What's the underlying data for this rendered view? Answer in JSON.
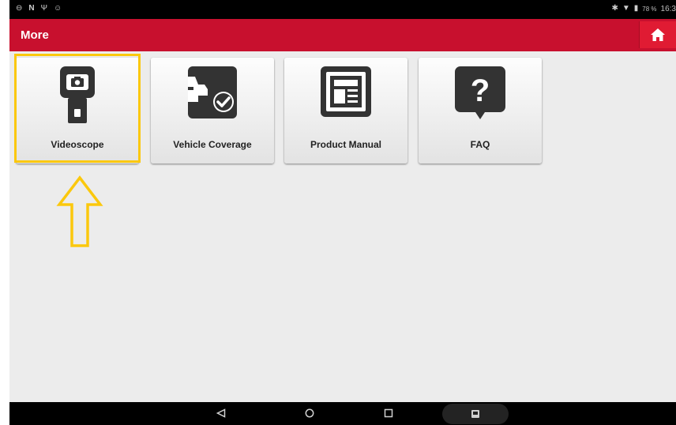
{
  "status_bar": {
    "left_icons": [
      "alarm-icon",
      "nfc-icon",
      "usb-icon",
      "android-icon"
    ],
    "battery": "78 %",
    "time": "16:3"
  },
  "app_bar": {
    "title": "More",
    "home_icon": "home-icon"
  },
  "tiles": [
    {
      "label": "Videoscope",
      "icon": "videoscope-icon"
    },
    {
      "label": "Vehicle Coverage",
      "icon": "vehicle-coverage-icon"
    },
    {
      "label": "Product Manual",
      "icon": "product-manual-icon"
    },
    {
      "label": "FAQ",
      "icon": "faq-icon"
    }
  ],
  "nav_bar": {
    "buttons": [
      "back-icon",
      "home-circle-icon",
      "recents-icon",
      "screenshot-icon"
    ]
  },
  "colors": {
    "app_bar": "#c8102e",
    "highlight": "#fbc80d",
    "icon": "#333333",
    "background": "#ececec"
  }
}
